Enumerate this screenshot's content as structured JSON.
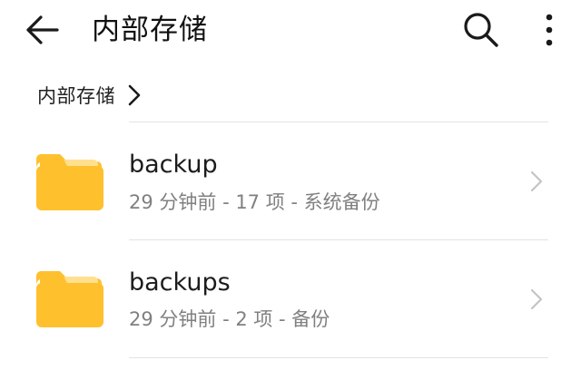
{
  "appbar": {
    "title": "内部存储",
    "back_icon": "arrow-left-icon",
    "search_icon": "search-icon",
    "more_icon": "more-vertical-icon"
  },
  "breadcrumb": {
    "label": "内部存储",
    "chevron_icon": "chevron-right-icon"
  },
  "files": [
    {
      "name": "backup",
      "meta": "29 分钟前 - 17 项 - 系统备份",
      "icon": "folder-icon"
    },
    {
      "name": "backups",
      "meta": "29 分钟前 - 2 项 - 备份",
      "icon": "folder-icon"
    }
  ],
  "colors": {
    "folder_main": "#FFC02E",
    "folder_tab": "#FFD978",
    "text_primary": "#1C1C1C",
    "text_secondary": "#808080",
    "divider": "#E3E3E3"
  }
}
